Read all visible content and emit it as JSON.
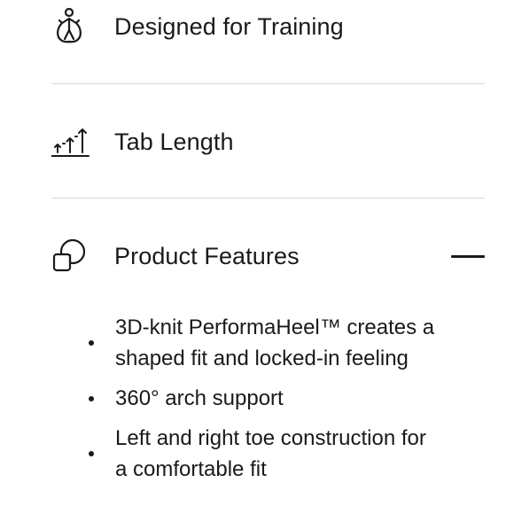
{
  "sections": [
    {
      "title": "Designed for Training",
      "icon": "jump-rope-person-icon",
      "expanded": false
    },
    {
      "title": "Tab Length",
      "icon": "tab-length-arrows-icon",
      "expanded": false
    },
    {
      "title": "Product Features",
      "icon": "product-features-shapes-icon",
      "expanded": true
    }
  ],
  "features": [
    "3D-knit PerformaHeel™ creates a shaped fit and locked-in feeling",
    "360° arch support",
    "Left and right toe construction for a comfortable fit"
  ],
  "colors": {
    "text": "#1a1a1a",
    "divider": "#d7d7d7",
    "background": "#ffffff"
  }
}
